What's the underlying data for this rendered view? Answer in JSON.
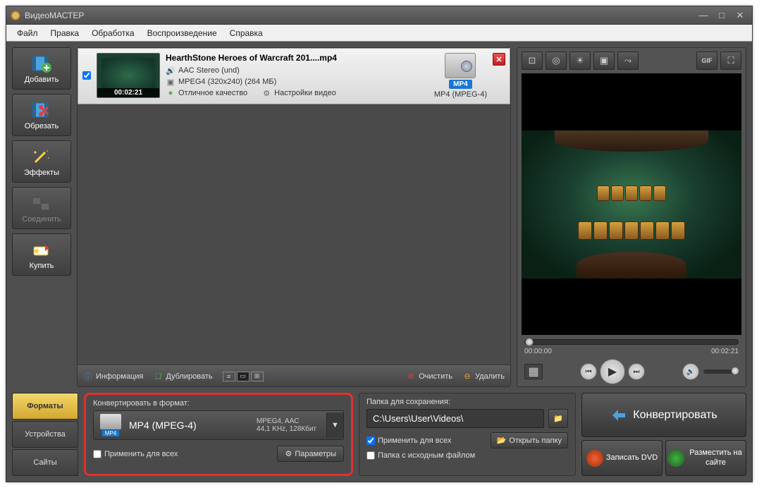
{
  "window": {
    "title": "ВидеоМАСТЕР"
  },
  "menu": {
    "file": "Файл",
    "edit": "Правка",
    "process": "Обработка",
    "playback": "Воспроизведение",
    "help": "Справка"
  },
  "sidebar": {
    "add": "Добавить",
    "crop": "Обрезать",
    "effects": "Эффекты",
    "join": "Соединить",
    "buy": "Купить"
  },
  "file": {
    "name": "HearthStone  Heroes of Warcraft 201....mp4",
    "audio": "AAC Stereo (und)",
    "video": "MPEG4 (320x240) (264 МБ)",
    "quality": "Отличное качество",
    "settings": "Настройки видео",
    "duration": "00:02:21",
    "format_badge": "MP4",
    "format_label": "MP4 (MPEG-4)"
  },
  "list_toolbar": {
    "info": "Информация",
    "duplicate": "Дублировать",
    "clear": "Очистить",
    "delete": "Удалить"
  },
  "preview": {
    "time_start": "00:00:00",
    "time_end": "00:02:21"
  },
  "tabs": {
    "formats": "Форматы",
    "devices": "Устройства",
    "sites": "Сайты"
  },
  "format_panel": {
    "header": "Конвертировать в формат:",
    "selected": "MP4 (MPEG-4)",
    "codec_line1": "MPEG4, AAC",
    "codec_line2": "44,1 KHz, 128Кбит",
    "badge": "MP4",
    "apply_all": "Применить для всех",
    "params": "Параметры"
  },
  "save_panel": {
    "header": "Папка для сохранения:",
    "path": "C:\\Users\\User\\Videos\\",
    "apply_all": "Применить для всех",
    "same_folder": "Папка с исходным файлом",
    "open_folder": "Открыть папку"
  },
  "actions": {
    "convert": "Конвертировать",
    "burn_dvd": "Записать DVD",
    "publish": "Разместить на сайте"
  }
}
